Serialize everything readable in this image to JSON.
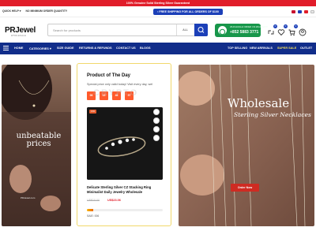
{
  "top_banner": {
    "text": "100% Genuine Solid Sterling Silver Guaranteed"
  },
  "utility": {
    "quick_help": "QUICK HELP ▾",
    "min_order": "NO MINIMUM ORDER QUANTITY",
    "free_shipping": "FREE SHIPPING FOR ALL ORDERS OF $100"
  },
  "header": {
    "logo": "PRJewel",
    "logo_sub": "WHOLESALE",
    "search_placeholder": "Search for products",
    "search_category": "ALL",
    "whatsapp_label": "WHOLESALE ORDER VIA WHATSAPP",
    "whatsapp_number": "+852 5883 3771",
    "compare_count": "0",
    "wishlist_count": "0",
    "cart_count": "0"
  },
  "nav": {
    "items_left": [
      "HOME",
      "CATEGORIES ▾",
      "SIZE GUIDE",
      "RETURNS & REFUNDS",
      "CONTACT US",
      "BLOGS"
    ],
    "items_right": [
      "TOP SELLING",
      "NEW ARRIVALS",
      "SUPER SALE",
      "OUTLET"
    ]
  },
  "left_banner": {
    "title": "unbeatable prices",
    "url": "PRJewel.com"
  },
  "product_of_day": {
    "title": "Product of The Day",
    "subtitle": "Special price only valid today! Visit every day, wel",
    "countdown": [
      "06",
      "15",
      "46",
      "57"
    ],
    "discount": "13%",
    "name": "Delicate Sterling Silver CZ Stacking Ring Minimalist Daily Jewelry Wholesale",
    "old_price": "US$10.00",
    "new_price": "US$23.06",
    "sold_label": "SAIE: 006",
    "sold_fraction": 0.08
  },
  "right_banner": {
    "title": "Wholesale",
    "subtitle": "Sterling Silver Necklaces",
    "button": "Order Now"
  },
  "colors": {
    "brand_blue": "#1b3fb8",
    "nav_blue": "#112d8a",
    "red": "#e11d2a",
    "whatsapp_green": "#17964a"
  }
}
